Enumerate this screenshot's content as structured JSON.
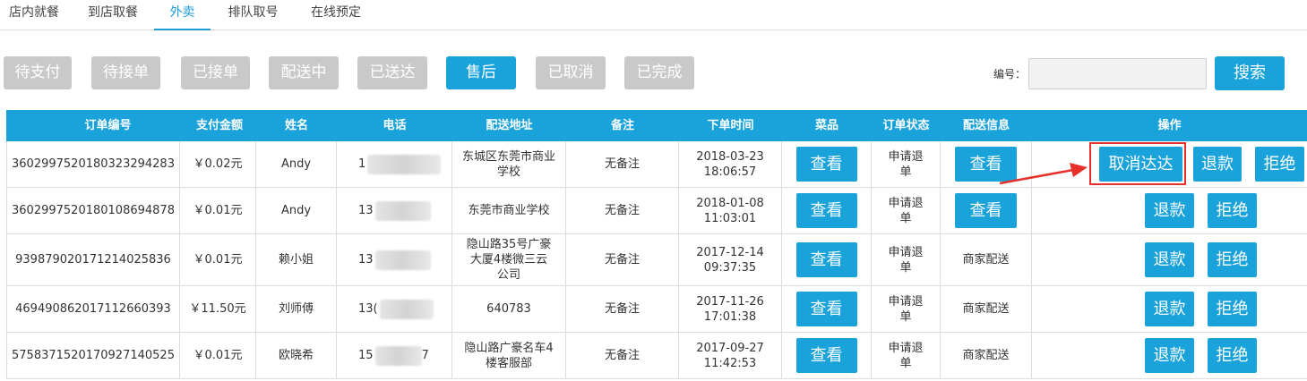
{
  "tabs": [
    {
      "label": "店内就餐"
    },
    {
      "label": "到店取餐"
    },
    {
      "label": "外卖"
    },
    {
      "label": "排队取号"
    },
    {
      "label": "在线预定"
    }
  ],
  "active_tab": "外卖",
  "filters": [
    {
      "label": "待支付"
    },
    {
      "label": "待接单"
    },
    {
      "label": "已接单"
    },
    {
      "label": "配送中"
    },
    {
      "label": "已送达"
    },
    {
      "label": "售后"
    },
    {
      "label": "已取消"
    },
    {
      "label": "已完成"
    }
  ],
  "active_filter": "售后",
  "search": {
    "label": "编号：",
    "value": "",
    "button_label": "搜索"
  },
  "colors": {
    "accent": "#1aa3db",
    "inactive": "#c9c9c9",
    "highlight": "#e8302a"
  },
  "table": {
    "headers": [
      "订单编号",
      "支付金额",
      "姓名",
      "电话",
      "配送地址",
      "备注",
      "下单时间",
      "菜品",
      "订单状态",
      "配送信息",
      "操作"
    ],
    "rows": [
      {
        "order_no": "3602997520180323294283",
        "amount": "￥0.02元",
        "name": "Andy",
        "phone": "1",
        "address": "东城区东莞市商业学校",
        "note": "无备注",
        "time": "2018-03-23 18:06:57",
        "dish_btn": "查看",
        "status": "申请退单",
        "delivery_btn": "查看",
        "delivery_text": "",
        "cancel_btn": "取消达达",
        "refund_btn": "退款",
        "reject_btn": "拒绝"
      },
      {
        "order_no": "3602997520180108694878",
        "amount": "￥0.01元",
        "name": "Andy",
        "phone": "13",
        "address": "东莞市商业学校",
        "note": "无备注",
        "time": "2018-01-08 11:03:01",
        "dish_btn": "查看",
        "status": "申请退单",
        "delivery_btn": "查看",
        "delivery_text": "",
        "refund_btn": "退款",
        "reject_btn": "拒绝"
      },
      {
        "order_no": "939879020171214025836",
        "amount": "￥0.01元",
        "name": "赖小姐",
        "phone": "13",
        "address": "隐山路35号广豪大厦4楼微三云公司",
        "note": "无备注",
        "time": "2017-12-14 09:37:35",
        "dish_btn": "查看",
        "status": "申请退单",
        "delivery_text": "商家配送",
        "refund_btn": "退款",
        "reject_btn": "拒绝"
      },
      {
        "order_no": "469490862017112660393",
        "amount": "￥11.50元",
        "name": "刘师傅",
        "phone": "13(",
        "address": "640783",
        "note": "无备注",
        "time": "2017-11-26 17:01:38",
        "dish_btn": "查看",
        "status": "申请退单",
        "delivery_text": "商家配送",
        "refund_btn": "退款",
        "reject_btn": "拒绝"
      },
      {
        "order_no": "5758371520170927140525",
        "amount": "￥0.01元",
        "name": "欧晓希",
        "phone": "15",
        "phone_suffix": "7",
        "address": "隐山路广豪名车4楼客服部",
        "note": "无备注",
        "time": "2017-09-27 11:42:53",
        "dish_btn": "查看",
        "status": "申请退单",
        "delivery_text": "商家配送",
        "refund_btn": "退款",
        "reject_btn": "拒绝"
      }
    ]
  }
}
